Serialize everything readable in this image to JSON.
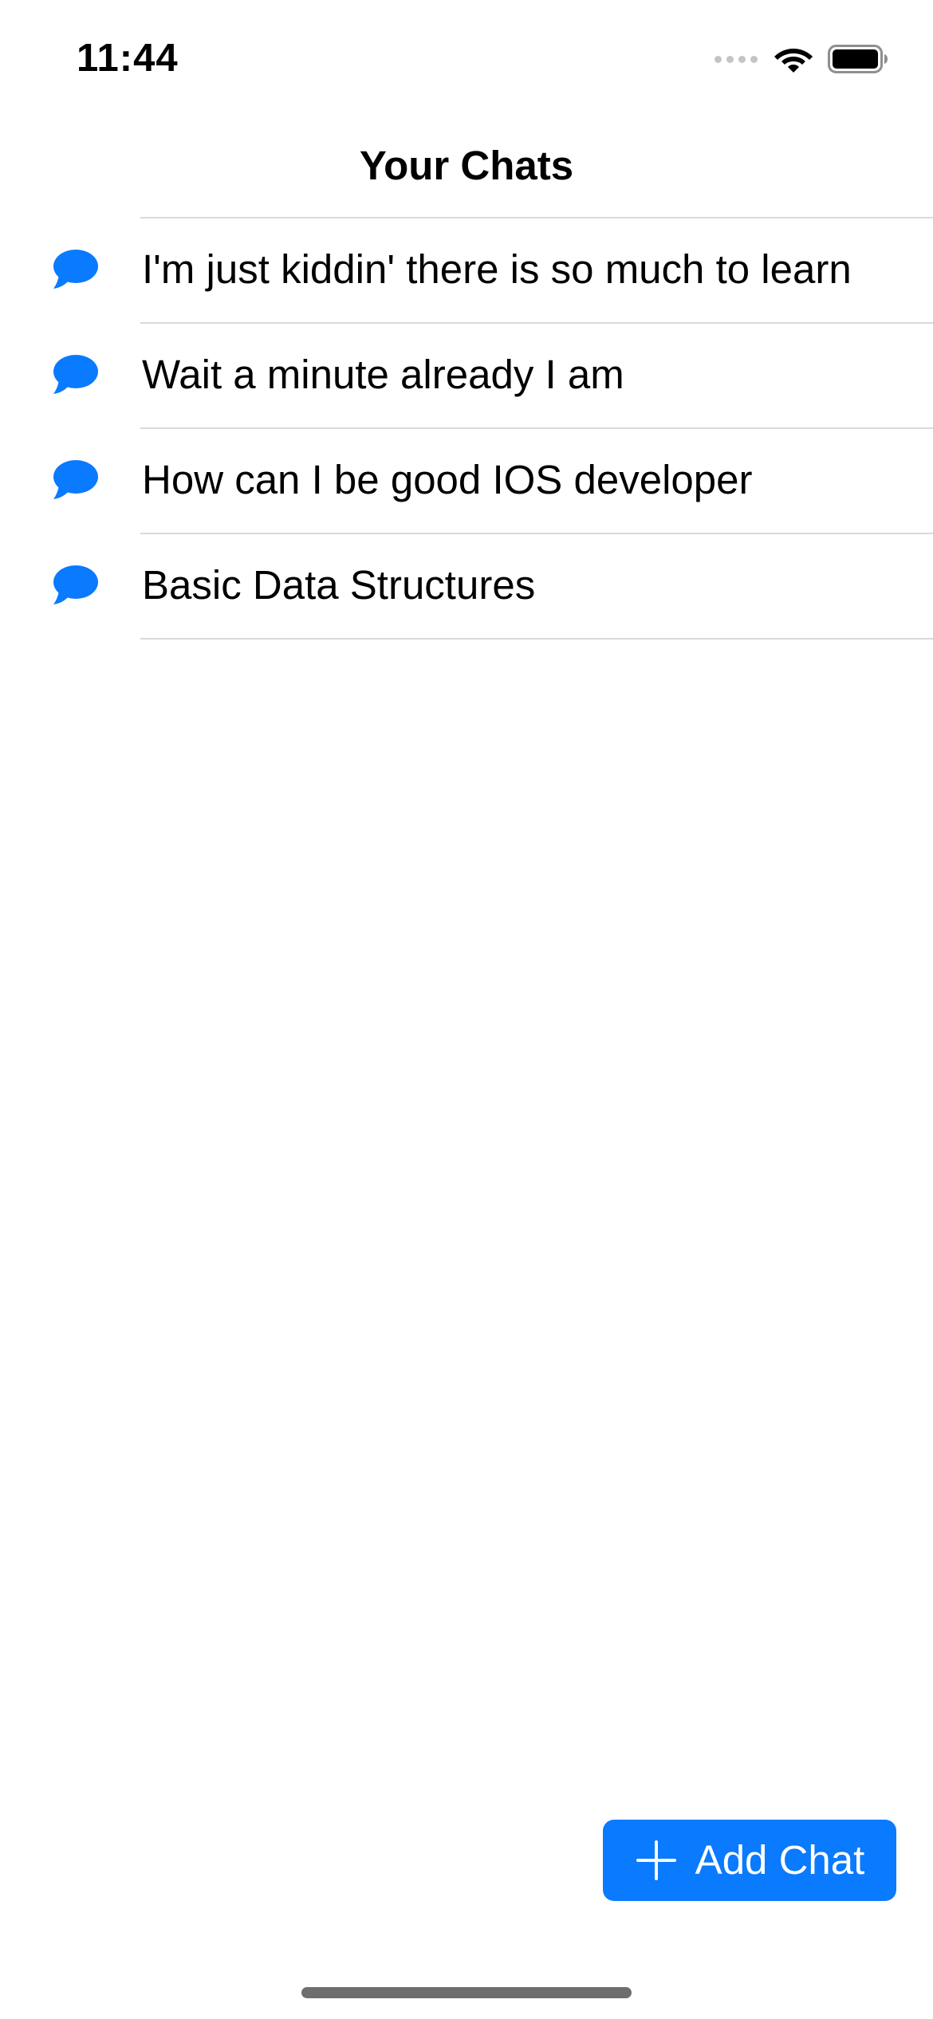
{
  "status_bar": {
    "time": "11:44",
    "icons": [
      "cellular-signal-icon",
      "wifi-icon",
      "battery-icon"
    ]
  },
  "header": {
    "title": "Your Chats"
  },
  "chats": [
    {
      "title": "I'm just kiddin' there is so much to learn",
      "icon": "chat-bubble-icon"
    },
    {
      "title": "Wait a minute already I am",
      "icon": "chat-bubble-icon"
    },
    {
      "title": "How can I be good IOS developer",
      "icon": "chat-bubble-icon"
    },
    {
      "title": "Basic Data Structures",
      "icon": "chat-bubble-icon"
    }
  ],
  "add_chat_button": {
    "label": "Add Chat",
    "icon": "plus-icon"
  },
  "colors": {
    "accent": "#0a7aff",
    "divider": "#d9d9dd",
    "text": "#000000",
    "background": "#ffffff"
  }
}
